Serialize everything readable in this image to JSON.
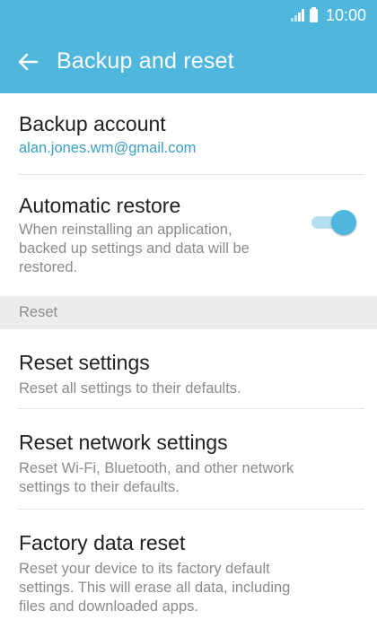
{
  "status_bar": {
    "time": "10:00",
    "signal_icon": "signal-bars-icon",
    "battery_icon": "battery-icon"
  },
  "app_bar": {
    "back_icon": "arrow-back-icon",
    "title": "Backup and reset",
    "background_color": "#4fb6dd"
  },
  "items": {
    "backup_account": {
      "title": "Backup account",
      "subtitle": "alan.jones.wm@gmail.com"
    },
    "automatic_restore": {
      "title": "Automatic restore",
      "subtitle_lines": [
        "When reinstalling an application,",
        "backed up settings and data will be",
        "restored."
      ],
      "toggle_on": true
    },
    "reset_section_header": "Reset",
    "reset_settings": {
      "title": "Reset settings",
      "subtitle": "Reset all settings to their defaults."
    },
    "reset_network_settings": {
      "title": "Reset network settings",
      "subtitle_lines": [
        "Reset Wi-Fi, Bluetooth, and other network",
        "settings to their defaults."
      ]
    },
    "factory_data_reset": {
      "title": "Factory data reset",
      "subtitle_lines": [
        "Reset your device to its factory default",
        "settings. This will erase all data, including",
        "files and downloaded apps."
      ]
    }
  },
  "colors": {
    "accent": "#4fb6dd",
    "link_text": "#3a9fc4",
    "toggle_track": "#b3dff0"
  }
}
